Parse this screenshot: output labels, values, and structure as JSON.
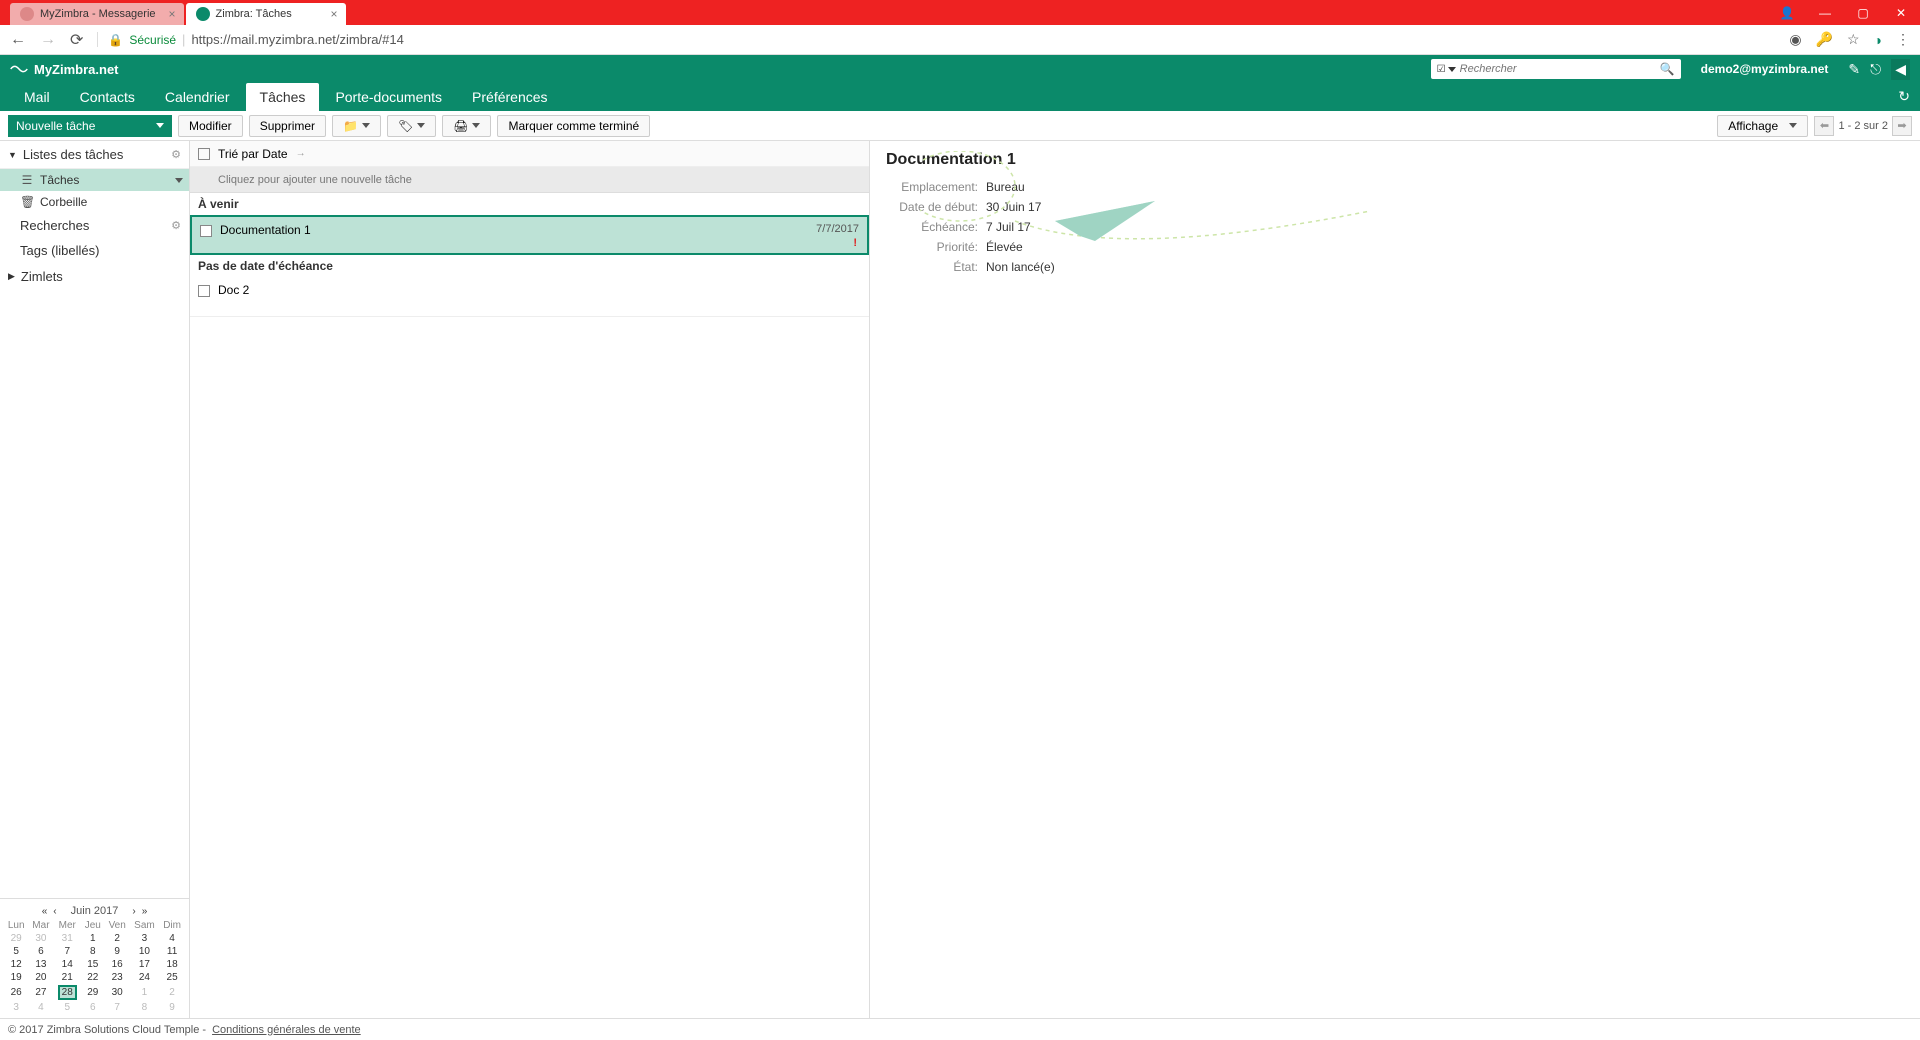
{
  "browser": {
    "tabs": [
      {
        "title": "MyZimbra - Messagerie",
        "active": false
      },
      {
        "title": "Zimbra: Tâches",
        "active": true
      }
    ],
    "secure_label": "Sécurisé",
    "url": "https://mail.myzimbra.net/zimbra/#14"
  },
  "header": {
    "brand": "MyZimbra.net",
    "search_placeholder": "Rechercher",
    "user": "demo2@myzimbra.net"
  },
  "nav": {
    "tabs": [
      "Mail",
      "Contacts",
      "Calendrier",
      "Tâches",
      "Porte-documents",
      "Préférences"
    ],
    "active_index": 3
  },
  "toolbar": {
    "new_task": "Nouvelle tâche",
    "edit": "Modifier",
    "delete": "Supprimer",
    "mark_done": "Marquer comme terminé",
    "view_label": "Affichage",
    "pager_text": "1 - 2 sur 2"
  },
  "sidebar": {
    "tasklists_header": "Listes des tâches",
    "items": [
      {
        "icon": "list",
        "label": "Tâches",
        "active": true
      },
      {
        "icon": "trash",
        "label": "Corbeille",
        "active": false
      }
    ],
    "searches": "Recherches",
    "tags": "Tags (libellés)",
    "zimlets": "Zimlets"
  },
  "minical": {
    "title": "Juin 2017",
    "dow": [
      "Lun",
      "Mar",
      "Mer",
      "Jeu",
      "Ven",
      "Sam",
      "Dim"
    ],
    "weeks": [
      [
        {
          "d": "29",
          "o": true
        },
        {
          "d": "30",
          "o": true
        },
        {
          "d": "31",
          "o": true
        },
        {
          "d": "1"
        },
        {
          "d": "2"
        },
        {
          "d": "3"
        },
        {
          "d": "4"
        }
      ],
      [
        {
          "d": "5"
        },
        {
          "d": "6"
        },
        {
          "d": "7"
        },
        {
          "d": "8"
        },
        {
          "d": "9"
        },
        {
          "d": "10"
        },
        {
          "d": "11"
        }
      ],
      [
        {
          "d": "12"
        },
        {
          "d": "13"
        },
        {
          "d": "14"
        },
        {
          "d": "15"
        },
        {
          "d": "16"
        },
        {
          "d": "17"
        },
        {
          "d": "18"
        }
      ],
      [
        {
          "d": "19"
        },
        {
          "d": "20"
        },
        {
          "d": "21"
        },
        {
          "d": "22"
        },
        {
          "d": "23"
        },
        {
          "d": "24"
        },
        {
          "d": "25"
        }
      ],
      [
        {
          "d": "26"
        },
        {
          "d": "27"
        },
        {
          "d": "28",
          "today": true
        },
        {
          "d": "29"
        },
        {
          "d": "30"
        },
        {
          "d": "1",
          "o": true
        },
        {
          "d": "2",
          "o": true
        }
      ],
      [
        {
          "d": "3",
          "o": true
        },
        {
          "d": "4",
          "o": true
        },
        {
          "d": "5",
          "o": true
        },
        {
          "d": "6",
          "o": true
        },
        {
          "d": "7",
          "o": true
        },
        {
          "d": "8",
          "o": true
        },
        {
          "d": "9",
          "o": true
        }
      ]
    ]
  },
  "tasklist": {
    "sort_label": "Trié par Date",
    "add_placeholder": "Cliquez pour ajouter une nouvelle tâche",
    "groups": [
      {
        "label": "À venir",
        "tasks": [
          {
            "title": "Documentation 1",
            "date": "7/7/2017",
            "priority_high": true,
            "selected": true
          }
        ]
      },
      {
        "label": "Pas de date d'échéance",
        "tasks": [
          {
            "title": "Doc 2",
            "date": "",
            "priority_high": false,
            "selected": false
          }
        ]
      }
    ]
  },
  "detail": {
    "title": "Documentation 1",
    "fields": {
      "location_label": "Emplacement:",
      "location_value": "Bureau",
      "start_label": "Date de début:",
      "start_value": "30 Juin 17",
      "due_label": "Échéance:",
      "due_value": "7 Juil 17",
      "priority_label": "Priorité:",
      "priority_value": "Élevée",
      "status_label": "État:",
      "status_value": "Non lancé(e)"
    }
  },
  "footer": {
    "copyright": "© 2017 Zimbra Solutions Cloud Temple -",
    "terms": "Conditions générales de vente"
  }
}
